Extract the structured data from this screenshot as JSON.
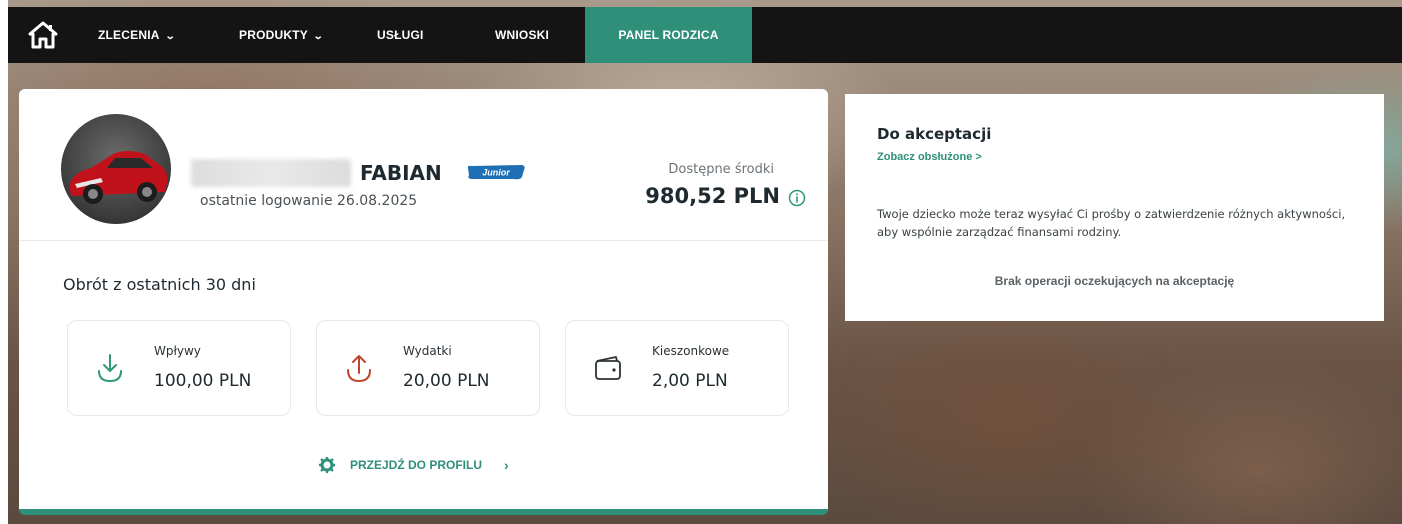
{
  "nav": {
    "items": [
      {
        "label": "ZLECENIA",
        "has_dropdown": true
      },
      {
        "label": "PRODUKTY",
        "has_dropdown": true
      },
      {
        "label": "USŁUGI",
        "has_dropdown": false
      },
      {
        "label": "WNIOSKI",
        "has_dropdown": false
      },
      {
        "label": "PANEL RODZICA",
        "has_dropdown": false,
        "active": true
      }
    ],
    "chevron": "⌄",
    "home_icon": "home-icon"
  },
  "child": {
    "name": "FABIAN",
    "badge": "Junior",
    "last_login": "ostatnie logowanie 26.08.2025",
    "funds_label": "Dostępne środki",
    "funds_value": "980,52 PLN"
  },
  "turnover": {
    "title": "Obrót z ostatnich 30 dni",
    "stats": [
      {
        "label": "Wpływy",
        "value": "100,00 PLN",
        "icon": "arrow-down-icon",
        "color": "#2e9a6e"
      },
      {
        "label": "Wydatki",
        "value": "20,00 PLN",
        "icon": "arrow-up-icon",
        "color": "#c0442a"
      },
      {
        "label": "Kieszonkowe",
        "value": "2,00 PLN",
        "icon": "wallet-icon",
        "color": "#2a3236"
      }
    ]
  },
  "profile_link": {
    "label": "PRZEJDŹ DO PROFILU",
    "arrow": "›"
  },
  "approval": {
    "title": "Do akceptacji",
    "link": "Zobacz obsłużone >",
    "description": "Twoje dziecko może teraz wysyłać Ci prośby o zatwierdzenie różnych aktywności, aby wspólnie zarządzać finansami rodziny.",
    "empty": "Brak operacji oczekujących na akceptację"
  },
  "colors": {
    "accent": "#2f8f79",
    "nav_bg": "#141414"
  }
}
